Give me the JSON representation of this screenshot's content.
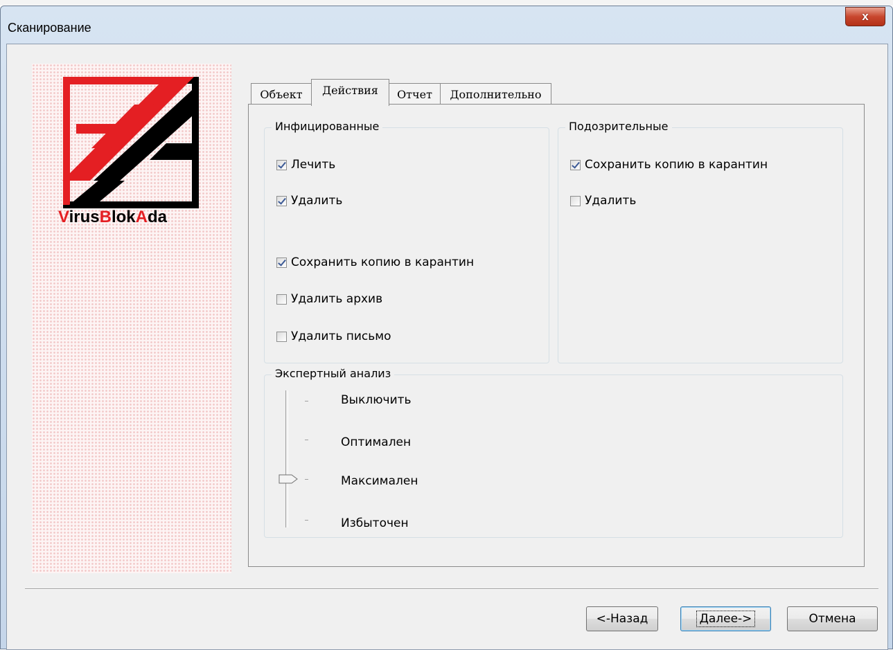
{
  "window": {
    "title": "Сканирование",
    "close_glyph": "x"
  },
  "logo": {
    "text_parts": [
      "V",
      "irus",
      "B",
      "lok",
      "A",
      "da"
    ]
  },
  "tabs": [
    {
      "label": "Объект",
      "active": false
    },
    {
      "label": "Действия",
      "active": true
    },
    {
      "label": "Отчет",
      "active": false
    },
    {
      "label": "Дополнительно",
      "active": false
    }
  ],
  "infected": {
    "title": "Инфицированные",
    "options": [
      {
        "label": "Лечить",
        "checked": true
      },
      {
        "label": "Удалить",
        "checked": true
      },
      {
        "label": "Сохранить копию в карантин",
        "checked": true
      },
      {
        "label": "Удалить архив",
        "checked": false
      },
      {
        "label": "Удалить письмо",
        "checked": false
      }
    ]
  },
  "suspicious": {
    "title": "Подозрительные",
    "options": [
      {
        "label": "Сохранить копию в карантин",
        "checked": true
      },
      {
        "label": "Удалить",
        "checked": false
      }
    ]
  },
  "expert": {
    "title": "Экспертный анализ",
    "levels": [
      "Выключить",
      "Оптимален",
      "Максимален",
      "Избыточен"
    ],
    "selected_level": "Максимален"
  },
  "buttons": {
    "back": "<-Назад",
    "next": "Далее->",
    "cancel": "Отмена"
  },
  "colors": {
    "brand_red": "#e41f23",
    "logo_black": "#000000",
    "accent_blue": "#3c7fb1"
  }
}
